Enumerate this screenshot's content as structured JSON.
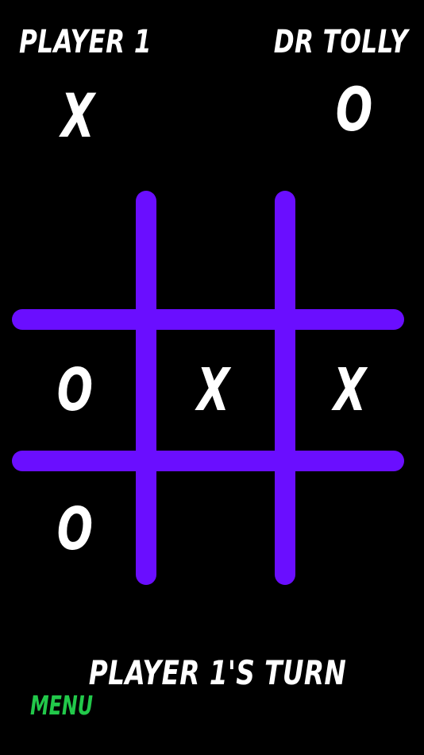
{
  "players": {
    "player1": {
      "name": "PLAYER 1",
      "mark": "X"
    },
    "player2": {
      "name": "DR TOLLY",
      "mark": "O"
    }
  },
  "board": {
    "cells": [
      [
        "",
        "",
        ""
      ],
      [
        "O",
        "X",
        "X"
      ],
      [
        "O",
        "",
        ""
      ]
    ]
  },
  "status": "PLAYER 1'S TURN",
  "menu_label": "MENU",
  "colors": {
    "background": "#000000",
    "grid": "#6a0eff",
    "text": "#ffffff",
    "menu": "#22c84a"
  }
}
